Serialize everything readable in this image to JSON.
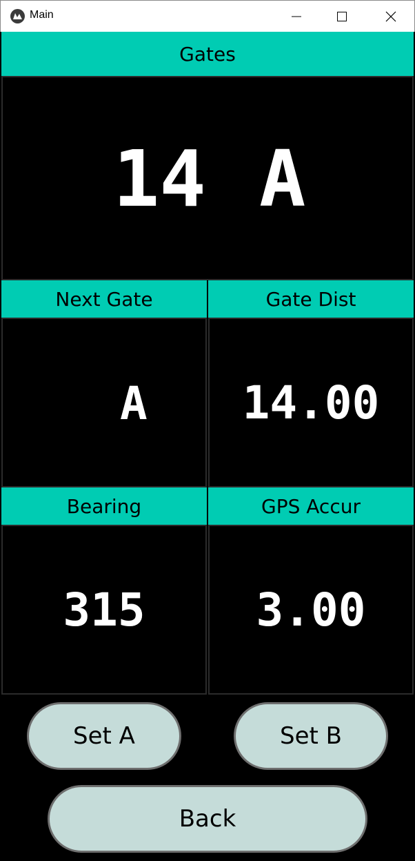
{
  "window": {
    "title": "Main",
    "icon": "kivy-app-icon"
  },
  "gates": {
    "header": "Gates",
    "number": "14",
    "letter": "A"
  },
  "next_gate": {
    "header": "Next Gate",
    "value": "A"
  },
  "gate_dist": {
    "header": "Gate Dist",
    "value": "14.00"
  },
  "bearing": {
    "header": "Bearing",
    "value": "315"
  },
  "gps_accur": {
    "header": "GPS Accur",
    "value": "3.00"
  },
  "buttons": {
    "set_a": "Set A",
    "set_b": "Set B",
    "back": "Back"
  },
  "colors": {
    "header_teal": "#00ccb3",
    "button_fill": "#c5dcd9",
    "background": "#000000",
    "value_text": "#ffffff"
  }
}
